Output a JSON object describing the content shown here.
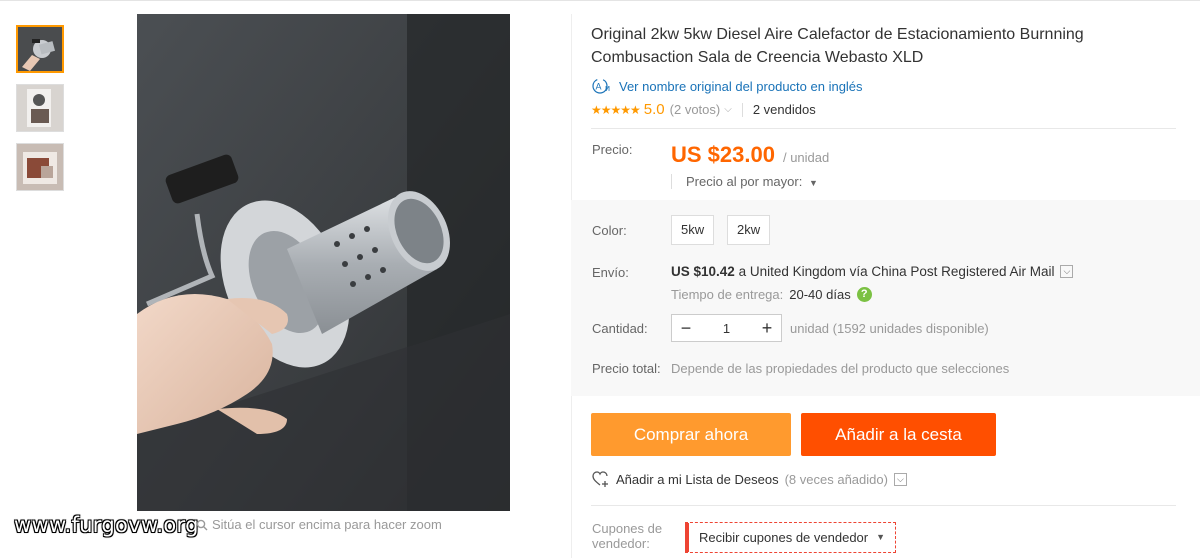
{
  "product": {
    "title": "Original 2kw 5kw Diesel Aire Calefactor de Estacionamiento Burnning Combusaction Sala de Creencia Webasto XLD",
    "view_original": "Ver nombre original del producto en inglés",
    "stars": "★★★★★",
    "score": "5.0",
    "votes": "(2 votos)",
    "sold": "2 vendidos"
  },
  "gallery": {
    "zoom_hint": "Sitúa el cursor encima para hacer zoom",
    "watermark": "www.furgovw.org"
  },
  "price": {
    "label": "Precio:",
    "amount": "US $23.00",
    "unit": "/ unidad",
    "wholesale": "Precio al por mayor:"
  },
  "color": {
    "label": "Color:",
    "options": [
      "5kw",
      "2kw"
    ]
  },
  "shipping": {
    "label": "Envío:",
    "cost": "US $10.42",
    "destination": "a United Kingdom vía China Post Registered Air Mail",
    "delivery_label": "Tiempo de entrega:",
    "delivery_days": "20-40 días"
  },
  "quantity": {
    "label": "Cantidad:",
    "value": "1",
    "minus": "−",
    "plus": "+",
    "note": "unidad (1592 unidades disponible)"
  },
  "total": {
    "label": "Precio total:",
    "note": "Depende de las propiedades del producto que selecciones"
  },
  "actions": {
    "buy_now": "Comprar ahora",
    "add_cart": "Añadir a la cesta",
    "wishlist": "Añadir a mi Lista de Deseos",
    "wishlist_count": "(8 veces añadido)"
  },
  "coupons": {
    "label": "Cupones de vendedor:",
    "button": "Recibir cupones de vendedor"
  },
  "colors": {
    "accent_orange": "#ff9a2e",
    "cart_red": "#ff4f00",
    "price": "#ff6600",
    "link": "#1a73b8"
  }
}
